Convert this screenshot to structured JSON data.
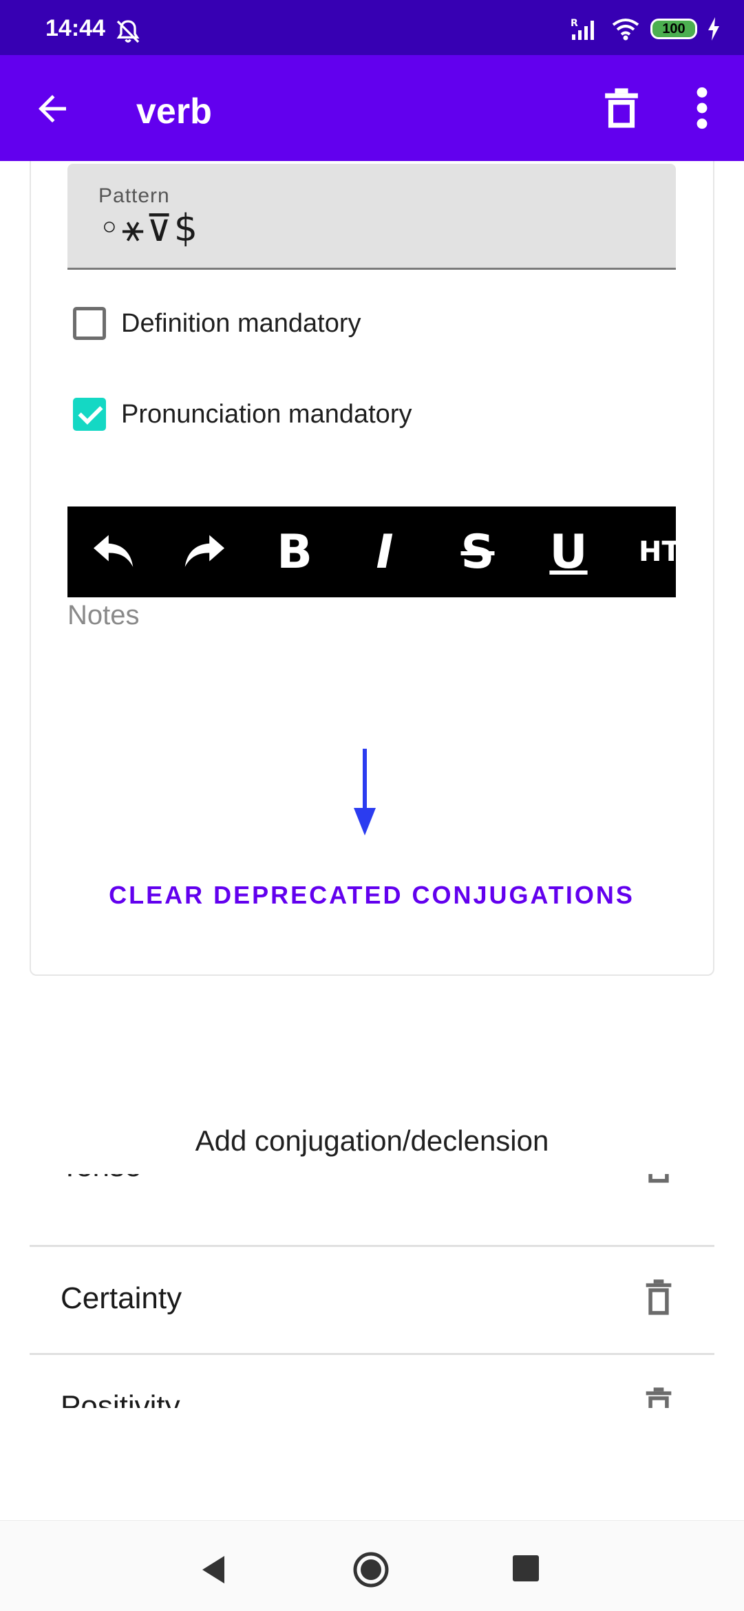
{
  "status_bar": {
    "time": "14:44",
    "battery": "100",
    "network_badge": "R"
  },
  "app_bar": {
    "title": "verb"
  },
  "form": {
    "pattern_label": "Pattern",
    "pattern_value": "◦⚹⊽$",
    "definition_mandatory": {
      "label": "Definition mandatory",
      "checked": false
    },
    "pronunciation_mandatory": {
      "label": "Pronunciation mandatory",
      "checked": true
    },
    "editor_toolbar": {
      "tools": [
        "undo",
        "redo",
        "bold",
        "italic",
        "strikethrough",
        "underline",
        "html"
      ],
      "bold_glyph": "B",
      "italic_glyph": "I",
      "strike_glyph": "S",
      "underline_glyph": "U",
      "html_glyph": "HT"
    },
    "notes_placeholder": "Notes",
    "clear_button": "CLEAR DEPRECATED CONJUGATIONS"
  },
  "conjugations": {
    "add_label": "Add conjugation/declension",
    "items": [
      {
        "label": "Tense"
      },
      {
        "label": "Certainty"
      },
      {
        "label": "Positivity"
      }
    ]
  },
  "colors": {
    "status_bar": "#3700b3",
    "app_bar": "#6200ee",
    "accent": "#14d8c4",
    "arrow": "#2b3cf0"
  }
}
